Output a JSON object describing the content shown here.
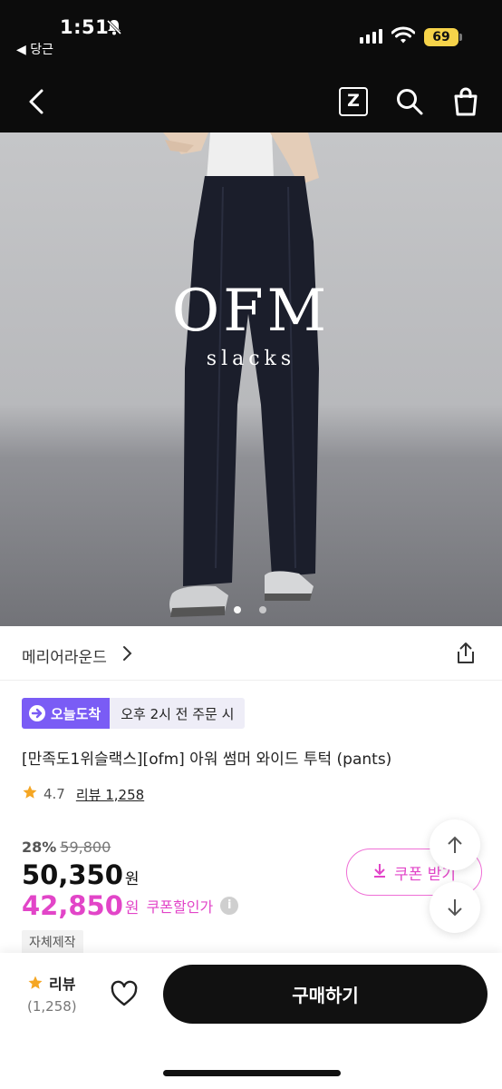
{
  "status_bar": {
    "time": "1:51",
    "back_app": "◀ 당근",
    "battery": "69",
    "icons": [
      "bell-slash-icon",
      "signal-icon",
      "wifi-icon",
      "battery-icon"
    ]
  },
  "navbar": {
    "logo_letter": "Z",
    "icons": [
      "back-arrow-icon",
      "zigzag-logo-icon",
      "search-icon",
      "shopping-bag-icon"
    ]
  },
  "hero": {
    "brand_text": "OFM",
    "sub_text": "slacks",
    "image_count": 2,
    "active_index": 0
  },
  "store": {
    "name": "메리어라운드",
    "icons": [
      "chevron-right-icon",
      "share-icon"
    ]
  },
  "delivery": {
    "badge_label": "오늘도착",
    "time_label": "오후 2시 전 주문 시",
    "badge_color": "#7a5cf5"
  },
  "product": {
    "title": "[만족도1위슬랙스][ofm] 아워 썸머 와이드 투턱 (pants)",
    "rating": "4.7",
    "review_link": "리뷰 1,258",
    "discount_percent": "28%",
    "original_price": "59,800",
    "price": "50,350",
    "price_unit": "원",
    "coupon_price": "42,850",
    "coupon_price_unit": "원",
    "coupon_price_label": "쿠폰할인가",
    "info_glyph": "i",
    "tag": "자체제작",
    "accent_color": "#e245c8"
  },
  "coupon_button": {
    "label": "쿠폰 받기"
  },
  "bottom_bar": {
    "review_label": "리뷰",
    "review_count": "(1,258)",
    "buy_label": "구매하기"
  }
}
